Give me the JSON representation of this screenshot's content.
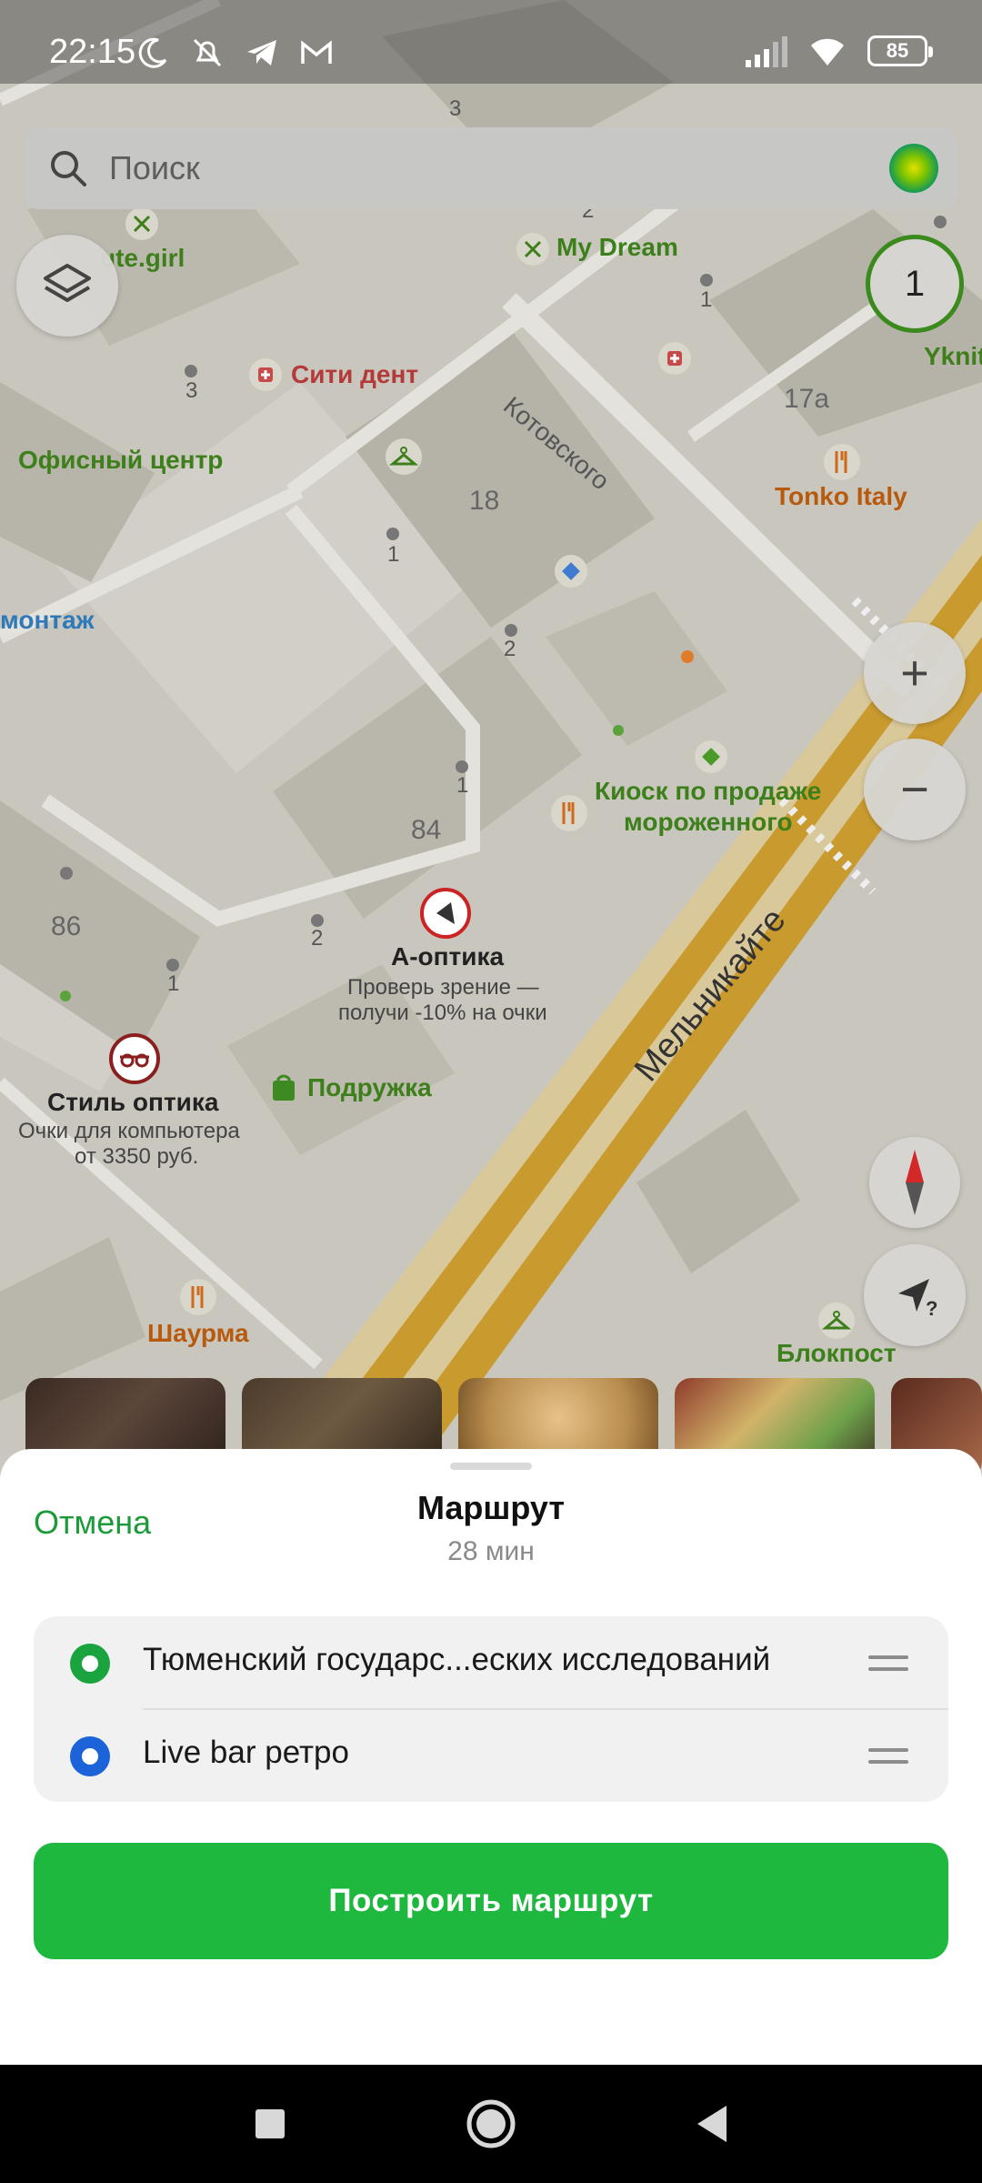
{
  "status_bar": {
    "time": "22:15",
    "battery": "85"
  },
  "search": {
    "placeholder": "Поиск"
  },
  "map": {
    "cluster_count": "1",
    "street_labels": [
      "Котовского",
      "Мельникайте"
    ],
    "building_numbers": [
      "3",
      "2",
      "1",
      "3",
      "17а",
      "18",
      "1",
      "2",
      "1",
      "84",
      "86",
      "2",
      "1"
    ],
    "places": [
      {
        "name": "ute.girl",
        "color": "#3d7f1a"
      },
      {
        "name": "My Dream",
        "color": "#3d7f1a"
      },
      {
        "name": "Сити дент",
        "color": "#b43a3a"
      },
      {
        "name": "Yknit",
        "color": "#3d7f1a"
      },
      {
        "name": "Офисный центр",
        "color": "#3d7f1a"
      },
      {
        "name": "Tonko Italy",
        "color": "#b85a0e"
      },
      {
        "name": "монтаж",
        "color": "#2f79b8"
      },
      {
        "name": "Киоск по продаже",
        "color": "#3d7f1a"
      },
      {
        "name": "мороженного",
        "color": "#3d7f1a"
      },
      {
        "name": "А-оптика",
        "color": "#222222"
      },
      {
        "name": "Проверь зрение —",
        "color": "#444444"
      },
      {
        "name": "получи -10% на очки",
        "color": "#444444"
      },
      {
        "name": "Стиль оптика",
        "color": "#222222"
      },
      {
        "name": "Очки для компьютера",
        "color": "#444444"
      },
      {
        "name": "от 3350 руб.",
        "color": "#444444"
      },
      {
        "name": "Подружка",
        "color": "#3d7f1a"
      },
      {
        "name": "Шаурма",
        "color": "#b85a0e"
      },
      {
        "name": "Блокпост",
        "color": "#3d7f1a"
      }
    ]
  },
  "controls": {
    "zoom_in": "+",
    "zoom_out": "−"
  },
  "sheet": {
    "cancel": "Отмена",
    "title": "Маршрут",
    "duration": "28 мин",
    "from": "Тюменский государс...еских исследований",
    "to": "Live bar ретро",
    "build_button": "Построить маршрут"
  },
  "colors": {
    "accent_green": "#1fb83f",
    "link_green": "#1d9a3a",
    "start_pin": "#1aa33f",
    "end_pin": "#1c62d8"
  }
}
